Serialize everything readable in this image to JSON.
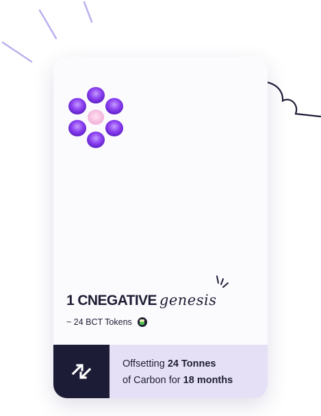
{
  "card": {
    "title": "1 CNEGATIVE",
    "title_script": "genesis",
    "tokens_text": "~ 24 BCT Tokens",
    "token_icon": "bct-token-icon",
    "offset": {
      "line1_prefix": "Offsetting",
      "line1_amount": "24 Tonnes",
      "line2_prefix": "of Carbon for",
      "line2_duration": "18 months"
    },
    "swap_icon": "swap-arrows-icon"
  },
  "colors": {
    "accent_purple": "#8b3ff0",
    "dark": "#1d1c36",
    "footer_bg": "#e6e0f6"
  }
}
